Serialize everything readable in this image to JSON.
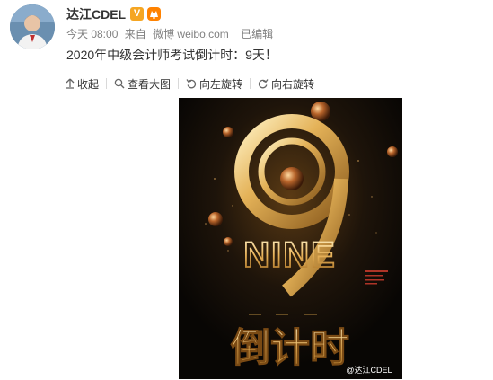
{
  "post": {
    "author": "达江CDEL",
    "verified_badge": "V",
    "meta": {
      "time": "今天 08:00",
      "source_prefix": "来自",
      "source": "微博 weibo.com",
      "edited": "已编辑"
    },
    "text": "2020年中级会计师考试倒计时：9天！"
  },
  "toolbar": {
    "collapse_label": "收起",
    "view_large_label": "查看大图",
    "rotate_left_label": "向左旋转",
    "rotate_right_label": "向右旋转"
  },
  "poster": {
    "watermark": "@达江CDEL",
    "big_number": "9",
    "number_word": "NINE",
    "countdown_text": "倒计时"
  },
  "colors": {
    "verified": "#f5a623",
    "gold": "#d9a54a",
    "poster_bg": "#0d0a07"
  }
}
